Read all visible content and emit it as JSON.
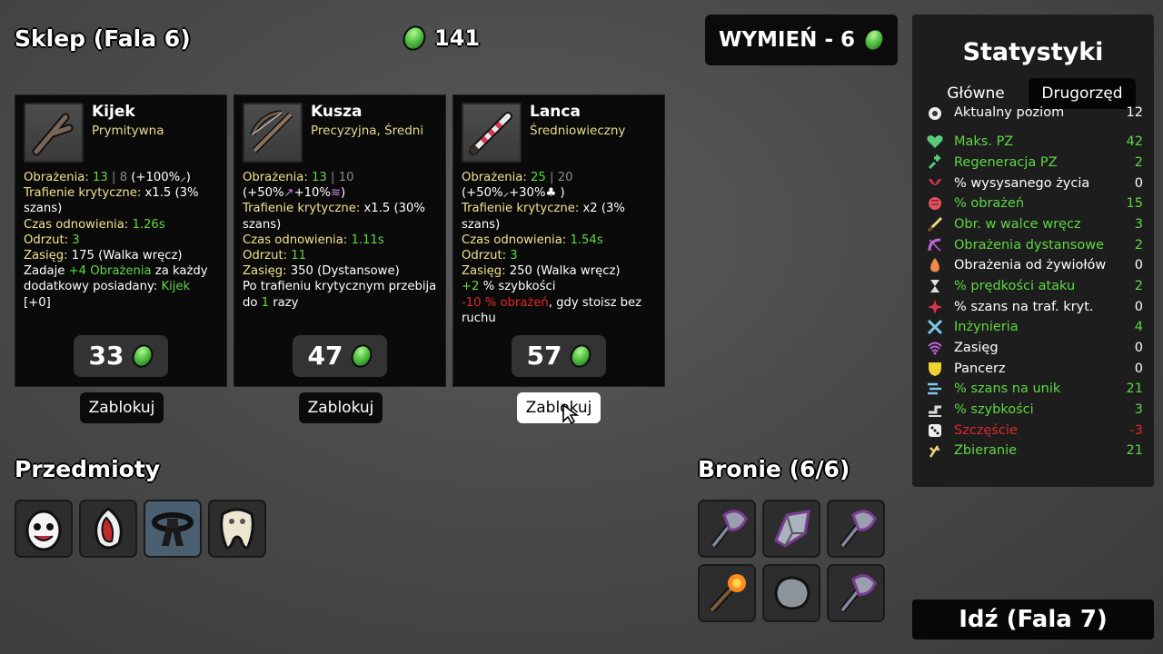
{
  "header": {
    "shop_title": "Sklep (Fala 6)",
    "money": "141",
    "reroll_label": "WYMIEŃ - 6"
  },
  "cards": [
    {
      "name": "Kijek",
      "class": "Prymitywna",
      "icon": "stick-icon",
      "price": "33",
      "lock_label": "Zablokuj",
      "dmg_label": "Obrażenia:",
      "dmg_val": "13",
      "dmg_sep": "|",
      "dmg_base": "8",
      "dmg_scale": "(+100%",
      "dmg_scale_icon": "melee-icon",
      "dmg_scale_end": ")",
      "crit_label": "Trafienie krytyczne:",
      "crit_val": "x1.5 (3% szans)",
      "cd_label": "Czas odnowienia:",
      "cd_val": "1.26s",
      "kb_label": "Odrzut:",
      "kb_val": "3",
      "range_label": "Zasięg:",
      "range_val": "175 (Walka wręcz)",
      "extra_1": "Zadaje",
      "extra_2": "+4 Obrażenia",
      "extra_3": "za każdy dodatkowy posiadany:",
      "extra_4": "Kijek",
      "extra_5": "[+0]"
    },
    {
      "name": "Kusza",
      "class": "Precyzyjna, Średni",
      "icon": "crossbow-icon",
      "price": "47",
      "lock_label": "Zablokuj",
      "dmg_label": "Obrażenia:",
      "dmg_val": "13",
      "dmg_sep": "|",
      "dmg_base": "10",
      "dmg_scale": "(+50%",
      "dmg_scale_2": "+10%",
      "dmg_scale_end": ")",
      "crit_label": "Trafienie krytyczne:",
      "crit_val": "x1.5 (30% szans)",
      "cd_label": "Czas odnowienia:",
      "cd_val": "1.11s",
      "kb_label": "Odrzut:",
      "kb_val": "11",
      "range_label": "Zasięg:",
      "range_val": "350 (Dystansowe)",
      "extra_1": "Po trafieniu krytycznym przebija do",
      "extra_2": "1",
      "extra_3": "razy"
    },
    {
      "name": "Lanca",
      "class": "Średniowieczny",
      "icon": "lance-icon",
      "price": "57",
      "lock_label": "Zablokuj",
      "dmg_label": "Obrażenia:",
      "dmg_val": "25",
      "dmg_sep": "|",
      "dmg_base": "20",
      "dmg_scale": "(+50%",
      "dmg_scale_2": "+30%",
      "dmg_scale_end": ")",
      "crit_label": "Trafienie krytyczne:",
      "crit_val": "x2 (3% szans)",
      "cd_label": "Czas odnowienia:",
      "cd_val": "1.54s",
      "kb_label": "Odrzut:",
      "kb_val": "3",
      "range_label": "Zasięg:",
      "range_val": "250 (Walka wręcz)",
      "extra_1": "+2",
      "extra_2": "% szybkości",
      "extra_3": "-10 % obrażeń",
      "extra_4": ", gdy stoisz bez ruchu"
    }
  ],
  "items": {
    "title": "Przedmioty",
    "slots": [
      "egg-creature-icon",
      "mouth-icon",
      "black-belt-icon",
      "tooth-icon"
    ]
  },
  "weapons": {
    "title": "Bronie (6/6)",
    "slots": [
      "axe-icon",
      "crystal-shard-icon",
      "axe-icon",
      "torch-icon",
      "stone-icon",
      "axe-icon"
    ]
  },
  "stats": {
    "title": "Statystyki",
    "tab_main": "Główne",
    "tab_secondary": "Drugorzęd",
    "rows": [
      {
        "icon": "level-icon",
        "label": "Aktualny poziom",
        "value": "12",
        "color": "#ffffff"
      },
      {
        "icon": "heart-icon",
        "label": "Maks. PZ",
        "value": "42",
        "color": "#5fd744"
      },
      {
        "icon": "regen-icon",
        "label": "Regeneracja PZ",
        "value": "2",
        "color": "#5fd744"
      },
      {
        "icon": "lifesteal-icon",
        "label": "% wysysanego życia",
        "value": "0",
        "color": "#ffffff"
      },
      {
        "icon": "damage-icon",
        "label": "% obrażeń",
        "value": "15",
        "color": "#5fd744"
      },
      {
        "icon": "melee-icon",
        "label": "Obr. w walce wręcz",
        "value": "3",
        "color": "#5fd744"
      },
      {
        "icon": "ranged-icon",
        "label": "Obrażenia dystansowe",
        "value": "2",
        "color": "#5fd744"
      },
      {
        "icon": "elemental-icon",
        "label": "Obrażenia od żywiołów",
        "value": "0",
        "color": "#ffffff"
      },
      {
        "icon": "attack-speed-icon",
        "label": "% prędkości ataku",
        "value": "2",
        "color": "#5fd744"
      },
      {
        "icon": "crit-icon",
        "label": "% szans na traf. kryt.",
        "value": "0",
        "color": "#ffffff"
      },
      {
        "icon": "engineering-icon",
        "label": "Inżynieria",
        "value": "4",
        "color": "#5fd744"
      },
      {
        "icon": "range-icon",
        "label": "Zasięg",
        "value": "0",
        "color": "#ffffff"
      },
      {
        "icon": "armor-icon",
        "label": "Pancerz",
        "value": "0",
        "color": "#ffffff"
      },
      {
        "icon": "dodge-icon",
        "label": "% szans na unik",
        "value": "21",
        "color": "#5fd744"
      },
      {
        "icon": "speed-icon",
        "label": "% szybkości",
        "value": "3",
        "color": "#5fd744"
      },
      {
        "icon": "luck-icon",
        "label": "Szczęście",
        "value": "-3",
        "color": "#e02828"
      },
      {
        "icon": "harvesting-icon",
        "label": "Zbieranie",
        "value": "21",
        "color": "#5fd744"
      }
    ]
  },
  "go_label": "Idź (Fala 7)",
  "colors": {
    "accent_green": "#5fd744",
    "label_yellow": "#eee38f",
    "negative_red": "#e02828"
  }
}
